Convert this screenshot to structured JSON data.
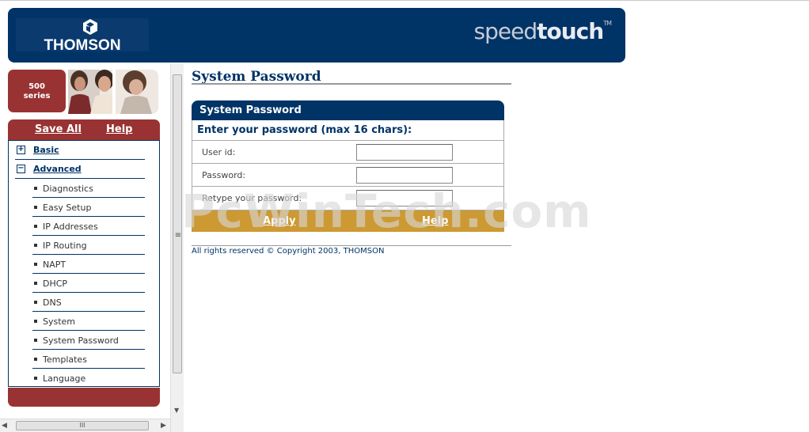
{
  "header": {
    "brand": "THOMSON",
    "product_light": "speed",
    "product_bold": "touch",
    "trademark": "TM"
  },
  "sidebar": {
    "series_number": "500",
    "series_label": "series",
    "save_all": "Save All",
    "help": "Help",
    "categories": [
      {
        "label": "Basic",
        "toggle": "+"
      },
      {
        "label": "Advanced",
        "toggle": "−"
      }
    ],
    "items": [
      "Diagnostics",
      "Easy Setup",
      "IP Addresses",
      "IP Routing",
      "NAPT",
      "DHCP",
      "DNS",
      "System",
      "System Password",
      "Templates",
      "Language"
    ]
  },
  "main": {
    "page_title": "System Password",
    "panel_title": "System Password",
    "prompt": "Enter your password (max 16 chars):",
    "fields": [
      {
        "label": "User id:",
        "value": ""
      },
      {
        "label": "Password:",
        "value": ""
      },
      {
        "label": "Retype your password:",
        "value": ""
      }
    ],
    "apply": "Apply",
    "help": "Help",
    "footer": "All rights reserved © Copyright 2003, THOMSON"
  },
  "watermark": "PcWinTech.com",
  "colors": {
    "navy": "#003366",
    "maroon": "#993333",
    "gold": "#cc9933"
  },
  "icons": {
    "grip": "≡",
    "thumb": "III"
  }
}
